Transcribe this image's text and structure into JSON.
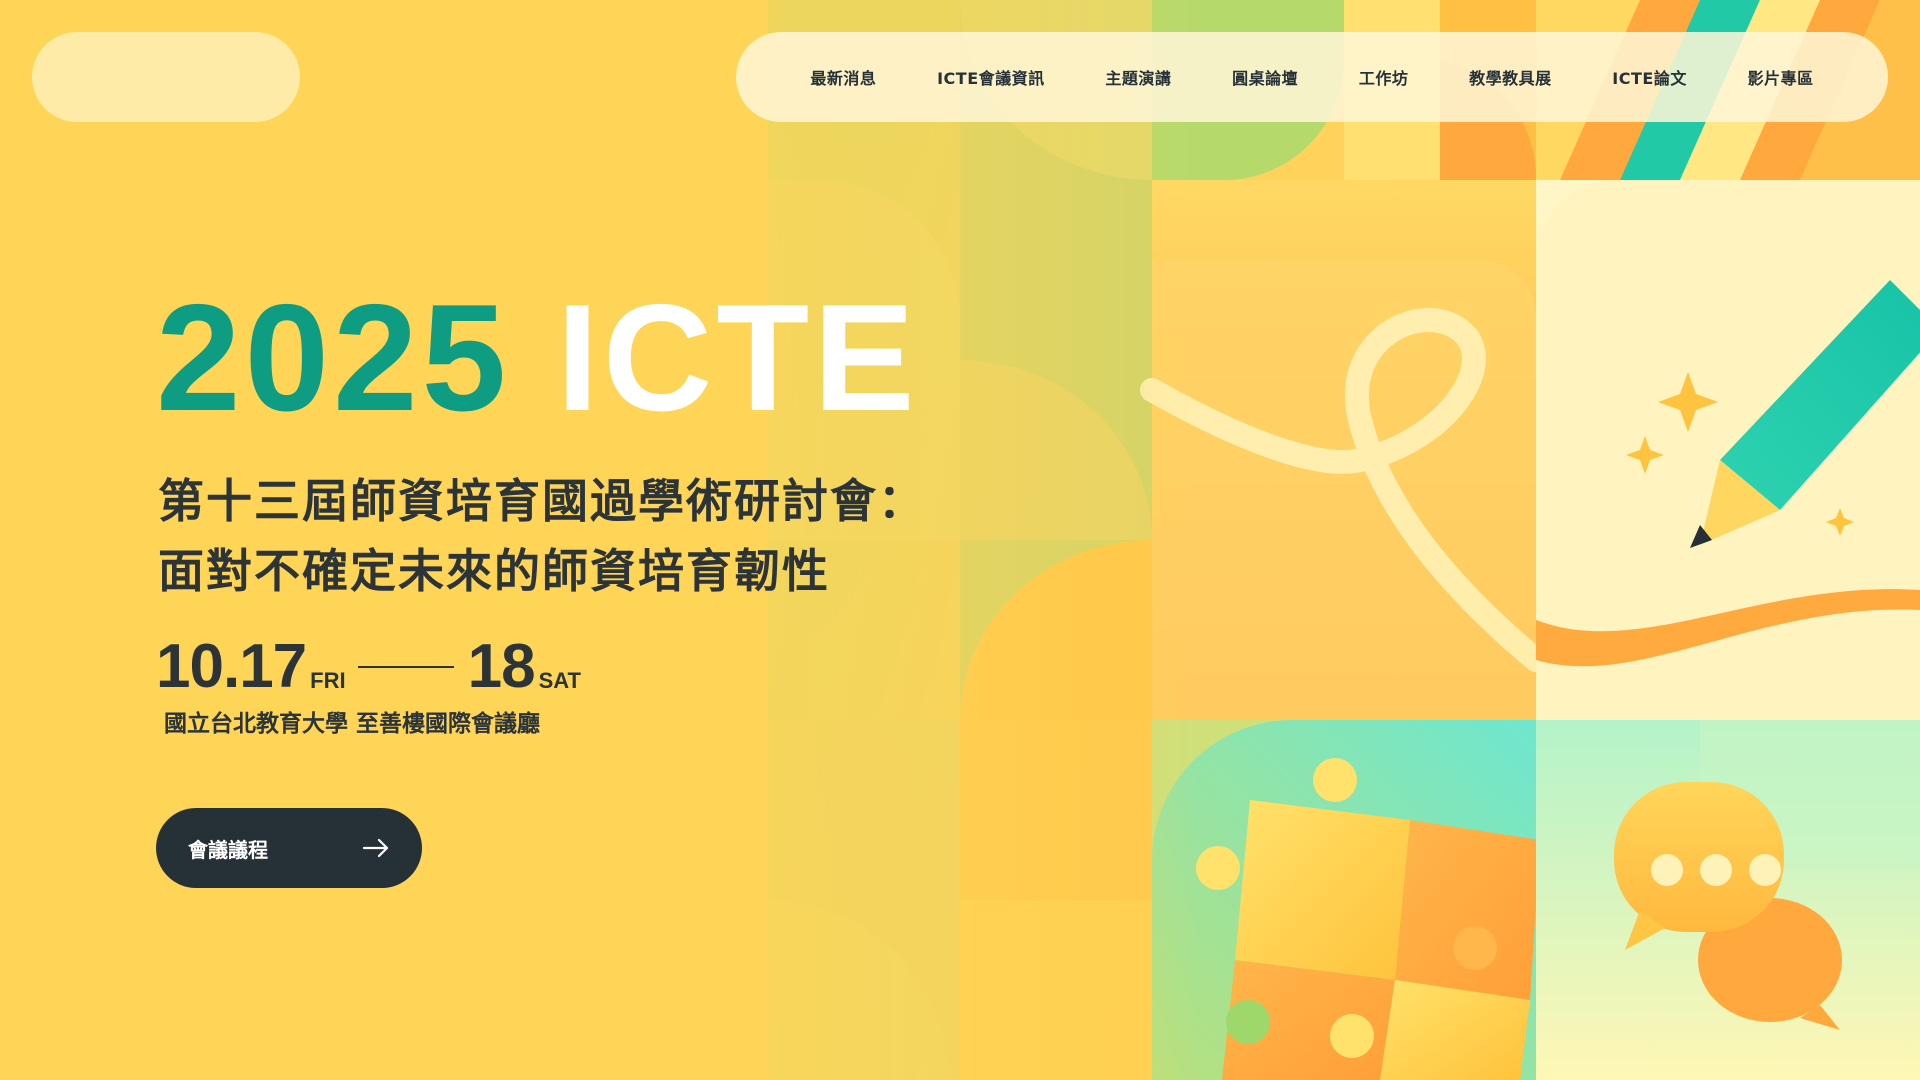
{
  "header": {
    "nav_items": [
      {
        "label": "最新消息"
      },
      {
        "label": "ICTE會議資訊"
      },
      {
        "label": "主題演講"
      },
      {
        "label": "圓桌論壇"
      },
      {
        "label": "工作坊"
      },
      {
        "label": "教學教具展"
      },
      {
        "label": "ICTE論文"
      },
      {
        "label": "影片專區"
      }
    ]
  },
  "hero": {
    "year": "2025",
    "name": "ICTE",
    "subtitle_line1": "第十三屆師資培育國過學術研討會：",
    "subtitle_line2": "面對不確定未來的師資培育韌性",
    "date_start": "10.17",
    "day_start": "FRI",
    "date_end": "18",
    "day_end": "SAT",
    "venue": "國立台北教育大學 至善樓國際會議廳",
    "cta_label": "會議議程"
  },
  "icons": [
    "arrow-right-icon",
    "pencil-icon",
    "sparkle-icon",
    "puzzle-icon",
    "chat-bubble-icon",
    "ribbon-loop-icon"
  ],
  "colors": {
    "background": "#FFD557",
    "accent_teal": "#0E9C83",
    "text_dark": "#2C3438",
    "button_dark": "#263037",
    "orange": "#FFA63D",
    "mint": "#2FD3B0"
  }
}
